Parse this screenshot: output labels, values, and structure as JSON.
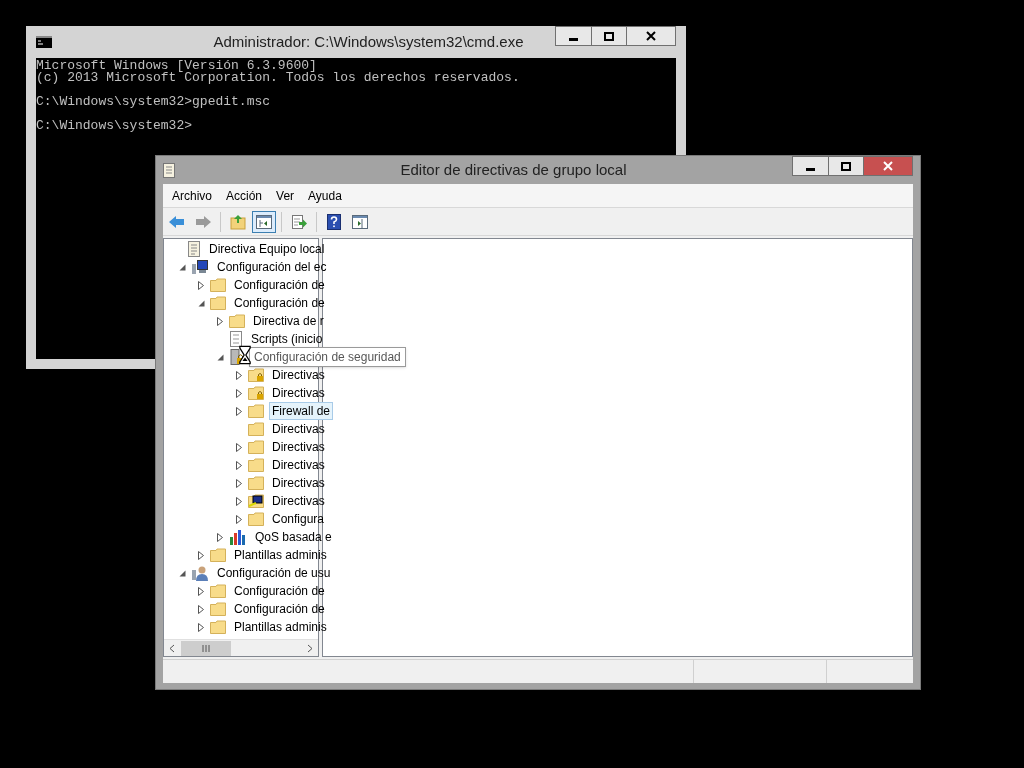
{
  "console_window": {
    "title": "Administrador: C:\\Windows\\system32\\cmd.exe",
    "active": false,
    "blocks": [
      [
        "Microsoft Windows [Versión 6.3.9600]",
        "(c) 2013 Microsoft Corporation. Todos los derechos reservados."
      ],
      [
        "C:\\Windows\\system32>gpedit.msc"
      ],
      [
        "C:\\Windows\\system32>"
      ]
    ]
  },
  "editor_window": {
    "title": "Editor de directivas de grupo local",
    "active": true,
    "menu": [
      "Archivo",
      "Acción",
      "Ver",
      "Ayuda"
    ],
    "toolbar": [
      {
        "kind": "back",
        "disabled": false,
        "pressed": false
      },
      {
        "kind": "forward",
        "disabled": true,
        "pressed": false
      },
      {
        "kind": "separator"
      },
      {
        "kind": "up",
        "disabled": false,
        "pressed": false
      },
      {
        "kind": "tree",
        "disabled": false,
        "pressed": true
      },
      {
        "kind": "separator"
      },
      {
        "kind": "export",
        "disabled": false,
        "pressed": false
      },
      {
        "kind": "separator"
      },
      {
        "kind": "help",
        "disabled": false,
        "pressed": false
      },
      {
        "kind": "pane",
        "disabled": false,
        "pressed": false
      }
    ],
    "tree": [
      {
        "label": "Directiva Equipo local",
        "kind": "document",
        "selected": false,
        "children": [
          {
            "label": "Configuración del ec",
            "kind": "computer",
            "expanded": true,
            "selected": false,
            "children": [
              {
                "label": "Configuración de",
                "kind": "folder",
                "expanded": false,
                "selected": false
              },
              {
                "label": "Configuración de",
                "kind": "folder",
                "expanded": true,
                "selected": false,
                "children": [
                  {
                    "label": "Directiva de r",
                    "kind": "folder",
                    "expanded": false,
                    "selected": false
                  },
                  {
                    "label": "Scripts (inicio",
                    "kind": "script",
                    "selected": false
                  },
                  {
                    "tooltip": "Configuración de seguridad",
                    "kind": "security",
                    "expanded": true,
                    "selected": false,
                    "children": [
                      {
                        "label": "Directivas",
                        "kind": "lock-folder",
                        "expanded": false,
                        "selected": false
                      },
                      {
                        "label": "Directivas",
                        "kind": "lock-folder",
                        "expanded": false,
                        "selected": false
                      },
                      {
                        "label": "Firewall de",
                        "kind": "folder",
                        "expanded": false,
                        "selected": true
                      },
                      {
                        "label": "Directivas",
                        "kind": "folder",
                        "selected": false
                      },
                      {
                        "label": "Directivas",
                        "kind": "folder",
                        "expanded": false,
                        "selected": false
                      },
                      {
                        "label": "Directivas",
                        "kind": "folder",
                        "expanded": false,
                        "selected": false
                      },
                      {
                        "label": "Directivas",
                        "kind": "folder",
                        "expanded": false,
                        "selected": false
                      },
                      {
                        "label": "Directivas",
                        "kind": "network",
                        "expanded": false,
                        "selected": false
                      },
                      {
                        "label": "Configura",
                        "kind": "folder",
                        "expanded": false,
                        "selected": false
                      }
                    ]
                  },
                  {
                    "label": "QoS basada e",
                    "kind": "chart",
                    "expanded": false,
                    "selected": false
                  }
                ]
              },
              {
                "label": "Plantillas adminis",
                "kind": "folder",
                "expanded": false,
                "selected": false
              }
            ]
          },
          {
            "label": "Configuración de usu",
            "kind": "user",
            "expanded": true,
            "selected": false,
            "children": [
              {
                "label": "Configuración de",
                "kind": "folder",
                "expanded": false,
                "selected": false
              },
              {
                "label": "Configuración de",
                "kind": "folder",
                "expanded": false,
                "selected": false
              },
              {
                "label": "Plantillas adminis",
                "kind": "folder",
                "expanded": false,
                "selected": false
              }
            ]
          }
        ]
      }
    ]
  }
}
